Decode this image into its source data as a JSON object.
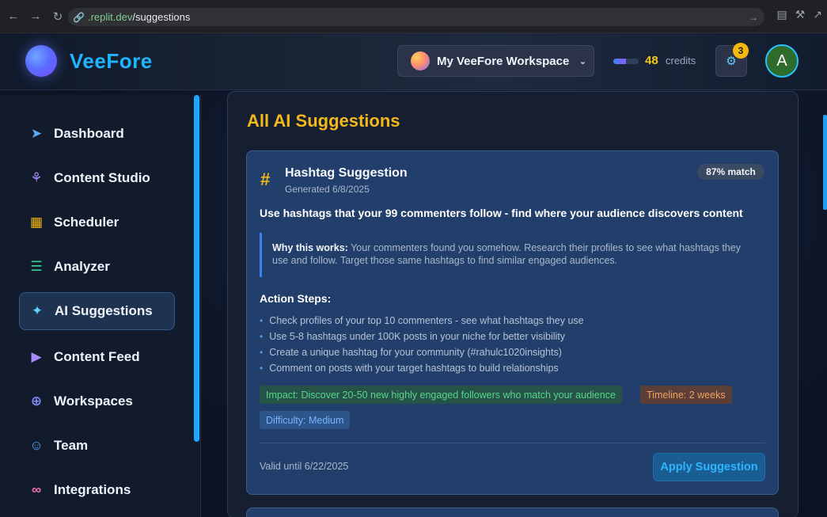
{
  "browser": {
    "url_host": ".replit.dev",
    "url_path": "/suggestions"
  },
  "header": {
    "app_name": "VeeFore",
    "workspace": "My VeeFore Workspace",
    "credits_value": "48",
    "credits_label": "credits",
    "credits_fraction": 0.5,
    "notification_count": "3",
    "user_initial": "A"
  },
  "sidebar": {
    "items": [
      {
        "label": "Dashboard",
        "icon": "rocket-icon",
        "color": "#5aa9ff"
      },
      {
        "label": "Content Studio",
        "icon": "brain-icon",
        "color": "#a78bfa"
      },
      {
        "label": "Scheduler",
        "icon": "calendar-icon",
        "color": "#f5b80f"
      },
      {
        "label": "Analyzer",
        "icon": "bar-chart-icon",
        "color": "#34d399"
      },
      {
        "label": "AI Suggestions",
        "icon": "sparkles-icon",
        "color": "#5fd0ff",
        "active": true
      },
      {
        "label": "Content Feed",
        "icon": "play-circle-icon",
        "color": "#a78bfa"
      },
      {
        "label": "Workspaces",
        "icon": "globe-icon",
        "color": "#818cf8"
      },
      {
        "label": "Team",
        "icon": "users-icon",
        "color": "#5aa9ff"
      },
      {
        "label": "Integrations",
        "icon": "link-icon",
        "color": "#f472b6"
      }
    ]
  },
  "main": {
    "title": "All AI Suggestions",
    "card": {
      "type": "Hashtag Suggestion",
      "date": "Generated 6/8/2025",
      "match": "87% match",
      "headline": "Use hashtags that your 99 commenters follow - find where your audience discovers content",
      "why_label": "Why this works:",
      "why_text": "Your commenters found you somehow. Research their profiles to see what hashtags they use and follow. Target those same hashtags to find similar engaged audiences.",
      "steps_title": "Action Steps:",
      "steps": [
        "Check profiles of your top 10 commenters - see what hashtags they use",
        "Use 5-8 hashtags under 100K posts in your niche for better visibility",
        "Create a unique hashtag for your community (#rahulc1020insights)",
        "Comment on posts with your target hashtags to build relationships"
      ],
      "impact": "Impact: Discover 20-50 new highly engaged followers who match your audience",
      "timeline": "Timeline: 2 weeks",
      "difficulty": "Difficulty: Medium",
      "valid_until": "Valid until 6/22/2025",
      "apply_label": "Apply Suggestion"
    }
  }
}
